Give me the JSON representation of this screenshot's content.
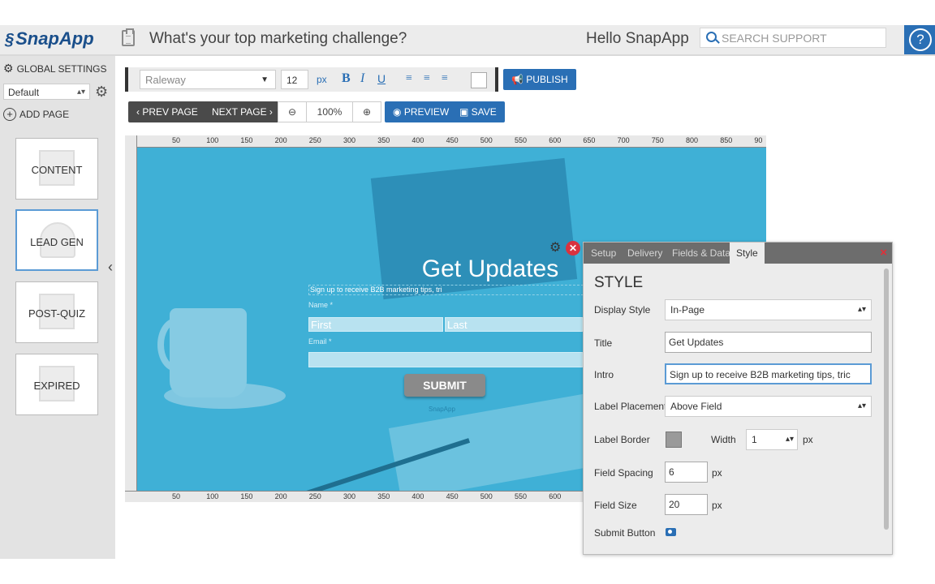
{
  "header": {
    "logo": "SnapApp",
    "title": "What's your top marketing challenge?",
    "greeting": "Hello SnapApp",
    "search_placeholder": "SEARCH SUPPORT",
    "help_glyph": "?"
  },
  "sidebar": {
    "global_settings": "GLOBAL SETTINGS",
    "theme": "Default",
    "add_page": "ADD PAGE",
    "pages": [
      {
        "label": "CONTENT"
      },
      {
        "label": "LEAD GEN"
      },
      {
        "label": "POST-QUIZ"
      },
      {
        "label": "EXPIRED"
      }
    ]
  },
  "toolbar": {
    "font": "Raleway",
    "size": "12",
    "size_unit": "px",
    "bold": "B",
    "italic": "I",
    "underline": "U",
    "publish": "PUBLISH",
    "prev_page": "PREV PAGE",
    "next_page": "NEXT PAGE",
    "zoom": "100%",
    "preview": "PREVIEW",
    "save": "SAVE"
  },
  "ruler": {
    "top": [
      "50",
      "100",
      "150",
      "200",
      "250",
      "300",
      "350",
      "400",
      "450",
      "500",
      "550",
      "600",
      "650",
      "700",
      "750",
      "800",
      "850",
      "90"
    ],
    "bottom": [
      "50",
      "100",
      "150",
      "200",
      "250",
      "300",
      "350",
      "400",
      "450",
      "500",
      "550",
      "600"
    ]
  },
  "form": {
    "title": "Get Updates",
    "intro": "Sign up to receive B2B marketing tips, tri",
    "name_label": "Name *",
    "first_placeholder": "First",
    "last_placeholder": "Last",
    "email_label": "Email *",
    "submit": "SUBMIT",
    "brand": "SnapApp"
  },
  "panel": {
    "tabs": [
      "Setup",
      "Delivery",
      "Fields & Data",
      "Style"
    ],
    "active_tab": "Style",
    "close": "×",
    "heading": "STYLE",
    "display_style_label": "Display Style",
    "display_style": "In-Page",
    "title_label": "Title",
    "title_value": "Get Updates",
    "intro_label": "Intro",
    "intro_value": "Sign up to receive B2B marketing tips, tric",
    "label_placement_label": "Label Placement",
    "label_placement": "Above Field",
    "label_border_label": "Label Border",
    "width_label": "Width",
    "width_value": "1",
    "px": "px",
    "field_spacing_label": "Field Spacing",
    "field_spacing": "6",
    "field_size_label": "Field Size",
    "field_size": "20",
    "submit_button_label": "Submit Button"
  },
  "colors": {
    "accent": "#2a6fb5",
    "canvas_bg": "#3fb0d6",
    "close_red": "#d9333f"
  },
  "icons": [
    "clipboard-icon",
    "search-icon",
    "help-icon",
    "gear-icon",
    "plus-circle-icon",
    "chevron-left-icon",
    "megaphone-icon",
    "zoom-out-icon",
    "zoom-in-icon",
    "eye-icon",
    "floppy-icon",
    "camera-icon",
    "close-icon"
  ]
}
